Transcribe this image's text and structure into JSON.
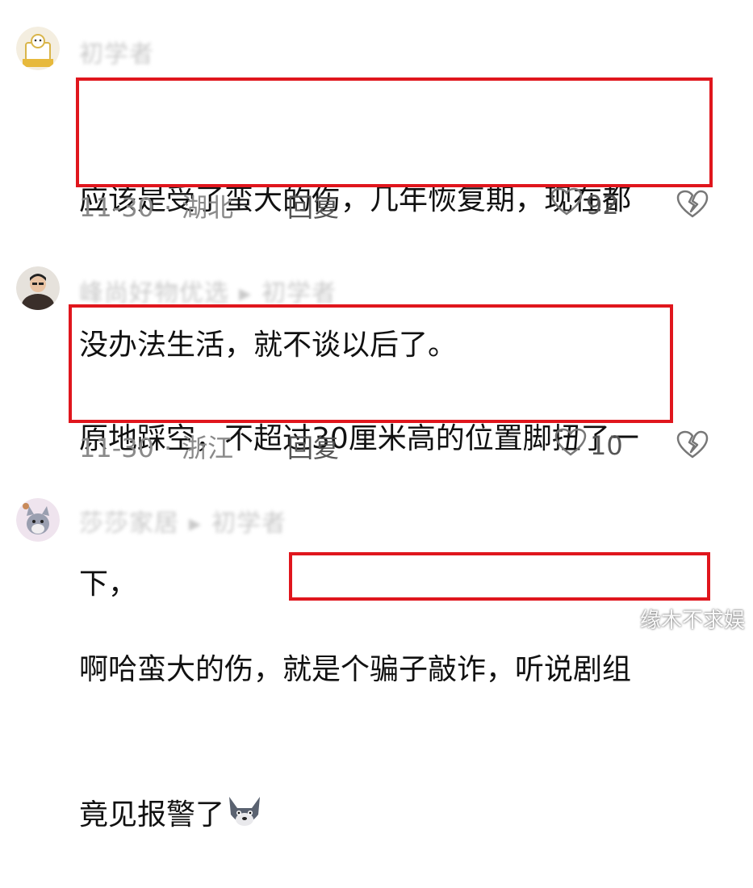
{
  "comments": [
    {
      "username": "初学者",
      "text_line1": "应该是受了蛮大的伤，几年恢复期，现在都",
      "text_line2": "没办法生活，就不谈以后了。",
      "date": "11-30",
      "location": "湖北",
      "reply_label": "回复",
      "likes": "92",
      "avatar_label": "初学者"
    },
    {
      "username": "峰尚好物优选",
      "reply_to": "初学者",
      "text_line1": "原地踩空，不超过30厘米高的位置脚扭了一",
      "text_line2": "下，",
      "date": "11-30",
      "location": "浙江",
      "reply_label": "回复",
      "likes": "10"
    },
    {
      "username": "莎莎家居",
      "reply_to": "初学者",
      "text_line1_plain": "啊哈蛮大的伤，",
      "text_line1_boxed": "就是个骗子敲诈，听说剧组",
      "text_line2": "竟见报警了"
    }
  ],
  "separator": "·",
  "watermark": "缘木不求娱",
  "colors": {
    "highlight_box": "#e0161d",
    "meta_text": "#8a8a8a",
    "username_blurred": "#c9c9c9"
  },
  "icons": [
    "heart-icon",
    "broken-heart-icon",
    "wolf-emoji"
  ]
}
